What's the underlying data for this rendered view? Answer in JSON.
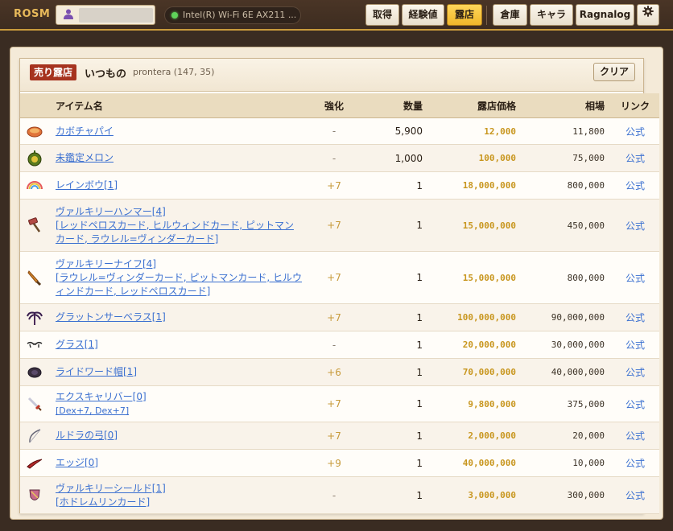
{
  "topbar": {
    "logo": "ROSM",
    "user_icon": "user-icon",
    "wifi_label": "Intel(R) Wi-Fi 6E AX211 ...",
    "buttons": [
      {
        "label": "取得"
      },
      {
        "label": "経験値"
      },
      {
        "label": "露店",
        "active": true
      },
      {
        "label": "倉庫"
      },
      {
        "label": "キャラ"
      },
      {
        "label": "Ragnalog"
      }
    ],
    "settings_icon": "gear-icon"
  },
  "shop": {
    "badge": "売り露店",
    "name": "いつもの",
    "location": "prontera (147, 35)",
    "clear_label": "クリア"
  },
  "table": {
    "headers": {
      "name": "アイテム名",
      "enhance": "強化",
      "qty": "数量",
      "price": "露店価格",
      "market": "相場",
      "link": "リンク"
    },
    "rows": [
      {
        "icon": "pumpkin-pie-icon",
        "name": "カボチャパイ",
        "cards": "",
        "enhance": "-",
        "qty": "5,900",
        "price": "12,000",
        "market": "11,800",
        "link": "公式"
      },
      {
        "icon": "melon-icon",
        "name": "未鑑定メロン",
        "cards": "",
        "enhance": "-",
        "qty": "1,000",
        "price": "100,000",
        "market": "75,000",
        "link": "公式"
      },
      {
        "icon": "rainbow-icon",
        "name": "レインボウ[1]",
        "cards": "",
        "enhance": "+7",
        "qty": "1",
        "price": "18,000,000",
        "market": "800,000",
        "link": "公式"
      },
      {
        "icon": "hammer-icon",
        "name": "ヴァルキリーハンマー[4]",
        "cards": "[レッドペロスカード, ヒルウィンドカード, ピットマンカード, ラウレル=ヴィンダーカード]",
        "enhance": "+7",
        "qty": "1",
        "price": "15,000,000",
        "market": "450,000",
        "link": "公式"
      },
      {
        "icon": "knife-icon",
        "name": "ヴァルキリーナイフ[4]",
        "cards": "[ラウレル=ヴィンダーカード, ピットマンカード, ヒルウィンドカード, レッドペロスカード]",
        "enhance": "+7",
        "qty": "1",
        "price": "15,000,000",
        "market": "800,000",
        "link": "公式"
      },
      {
        "icon": "glutton-icon",
        "name": "グラットンサーベラス[1]",
        "cards": "",
        "enhance": "+7",
        "qty": "1",
        "price": "100,000,000",
        "market": "90,000,000",
        "link": "公式"
      },
      {
        "icon": "glasses-icon",
        "name": "グラス[1]",
        "cards": "",
        "enhance": "-",
        "qty": "1",
        "price": "20,000,000",
        "market": "30,000,000",
        "link": "公式"
      },
      {
        "icon": "rideword-hat-icon",
        "name": "ライドワード帽[1]",
        "cards": "",
        "enhance": "+6",
        "qty": "1",
        "price": "70,000,000",
        "market": "40,000,000",
        "link": "公式"
      },
      {
        "icon": "sword-icon",
        "name": "エクスキャリバー[0]",
        "cards": "[Dex+7, Dex+7]",
        "enhance": "+7",
        "qty": "1",
        "price": "9,800,000",
        "market": "375,000",
        "link": "公式"
      },
      {
        "icon": "bow-icon",
        "name": "ルドラの弓[0]",
        "cards": "",
        "enhance": "+7",
        "qty": "1",
        "price": "2,000,000",
        "market": "20,000",
        "link": "公式"
      },
      {
        "icon": "edge-icon",
        "name": "エッジ[0]",
        "cards": "",
        "enhance": "+9",
        "qty": "1",
        "price": "40,000,000",
        "market": "10,000",
        "link": "公式"
      },
      {
        "icon": "shield-icon",
        "name": "ヴァルキリーシールド[1]",
        "cards": "[ホドレムリンカード]",
        "enhance": "-",
        "qty": "1",
        "price": "3,000,000",
        "market": "300,000",
        "link": "公式"
      }
    ]
  }
}
